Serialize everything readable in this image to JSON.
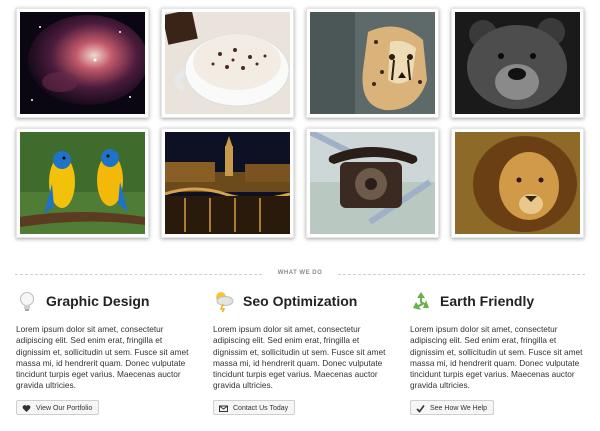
{
  "gallery": {
    "images": [
      {
        "alt": "nebula"
      },
      {
        "alt": "hot-chocolate"
      },
      {
        "alt": "cheetah"
      },
      {
        "alt": "bear"
      },
      {
        "alt": "parrots"
      },
      {
        "alt": "paris-night"
      },
      {
        "alt": "telephone"
      },
      {
        "alt": "lion"
      }
    ]
  },
  "section": {
    "divider_label": "WHAT WE DO"
  },
  "services": [
    {
      "title": "Graphic Design",
      "icon": "lightbulb-icon",
      "body": "Lorem ipsum dolor sit amet, consectetur adipiscing elit. Sed enim erat, fringilla et dignissim et, sollicitudin ut sem. Fusce sit amet massa mi, id hendrerit quam. Donec vulputate tincidunt turpis eget varius. Maecenas auctor gravida ultricies.",
      "button_label": "View Our Portfolio",
      "button_icon": "heart-icon"
    },
    {
      "title": "Seo Optimization",
      "icon": "weather-icon",
      "body": "Lorem ipsum dolor sit amet, consectetur adipiscing elit. Sed enim erat, fringilla et dignissim et, sollicitudin ut sem. Fusce sit amet massa mi, id hendrerit quam. Donec vulputate tincidunt turpis eget varius. Maecenas auctor gravida ultricies.",
      "button_label": "Contact Us Today",
      "button_icon": "envelope-icon"
    },
    {
      "title": "Earth Friendly",
      "icon": "recycle-icon",
      "body": "Lorem ipsum dolor sit amet, consectetur adipiscing elit. Sed enim erat, fringilla et dignissim et, sollicitudin ut sem. Fusce sit amet massa mi, id hendrerit quam. Donec vulputate tincidunt turpis eget varius. Maecenas auctor gravida ultricies.",
      "button_label": "See How We Help",
      "button_icon": "check-icon"
    }
  ],
  "colors": {
    "accent_green": "#6ab04c",
    "button_bg": "#f6f6f6",
    "text": "#333333"
  }
}
